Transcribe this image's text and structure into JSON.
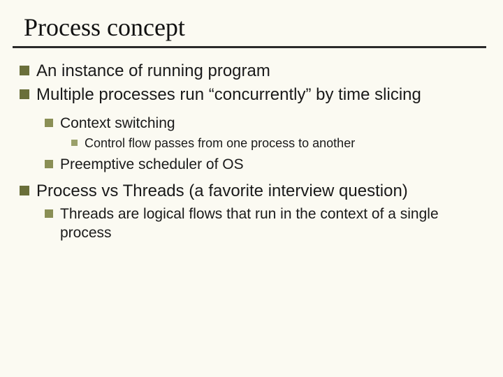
{
  "title": "Process concept",
  "b1": "An instance of running program",
  "b2": "Multiple processes run “concurrently” by time slicing",
  "b2_1": "Context switching",
  "b2_1_1": "Control flow passes from one process to another",
  "b2_2": "Preemptive scheduler of OS",
  "b3": "Process vs Threads (a favorite interview question)",
  "b3_1": "Threads are logical flows that run in the context of a single process"
}
